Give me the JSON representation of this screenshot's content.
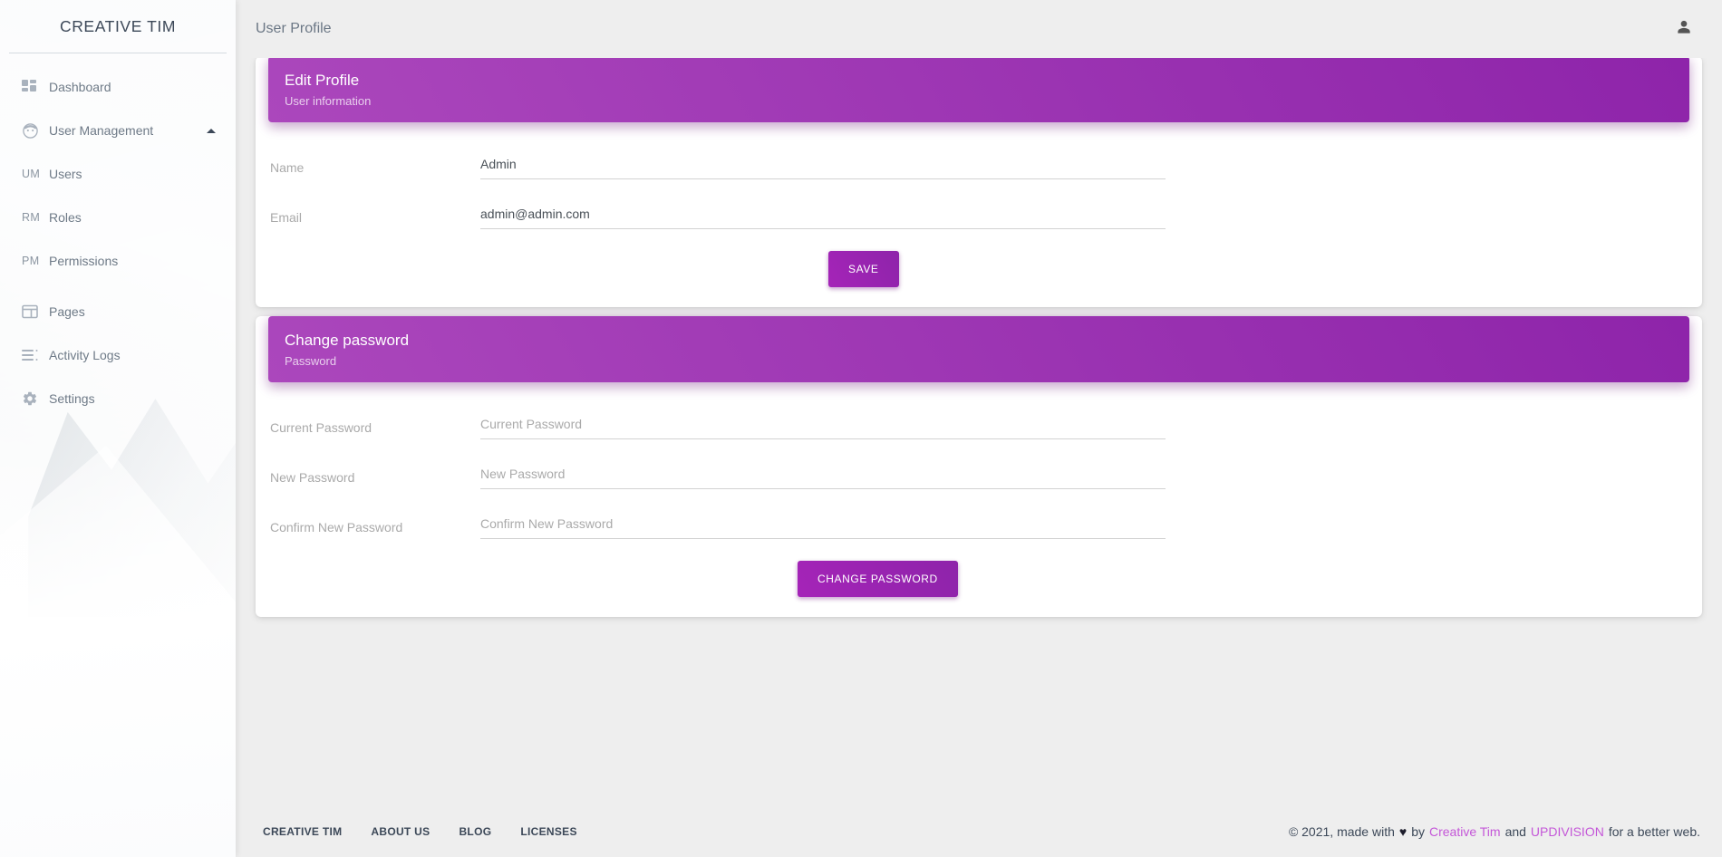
{
  "brand": {
    "name": "CREATIVE TIM"
  },
  "sidebar": {
    "items": [
      {
        "label": "Dashboard",
        "icon": "dashboard-grid-icon",
        "type": "icon"
      },
      {
        "label": "User Management",
        "icon": "user-face-icon",
        "type": "icon",
        "expanded": true,
        "caret": "chevron-up-icon"
      },
      {
        "label": "Users",
        "abbr": "UM",
        "type": "abbr"
      },
      {
        "label": "Roles",
        "abbr": "RM",
        "type": "abbr"
      },
      {
        "label": "Permissions",
        "abbr": "PM",
        "type": "abbr"
      },
      {
        "label": "Pages",
        "icon": "pages-layout-icon",
        "type": "icon"
      },
      {
        "label": "Activity Logs",
        "icon": "list-lines-icon",
        "type": "icon"
      },
      {
        "label": "Settings",
        "icon": "gear-icon",
        "type": "icon"
      }
    ]
  },
  "topbar": {
    "title": "User Profile",
    "account_icon": "person-icon"
  },
  "cards": {
    "edit_profile": {
      "title": "Edit Profile",
      "subtitle": "User information",
      "fields": [
        {
          "label": "Name",
          "value": "Admin",
          "placeholder": "Name",
          "type": "text"
        },
        {
          "label": "Email",
          "value": "admin@admin.com",
          "placeholder": "Email",
          "type": "email"
        }
      ],
      "submit_label": "SAVE"
    },
    "change_password": {
      "title": "Change password",
      "subtitle": "Password",
      "fields": [
        {
          "label": "Current Password",
          "value": "",
          "placeholder": "Current Password",
          "type": "password"
        },
        {
          "label": "New Password",
          "value": "",
          "placeholder": "New Password",
          "type": "password"
        },
        {
          "label": "Confirm New Password",
          "value": "",
          "placeholder": "Confirm New Password",
          "type": "password"
        }
      ],
      "submit_label": "CHANGE PASSWORD"
    }
  },
  "footer": {
    "links": [
      {
        "label": "CREATIVE TIM"
      },
      {
        "label": "ABOUT US"
      },
      {
        "label": "BLOG"
      },
      {
        "label": "LICENSES"
      }
    ],
    "copyright_prefix": "© 2021, made with",
    "heart": "♥",
    "by": "by",
    "link1": "Creative Tim",
    "and": "and",
    "link2": "UPDIVISION",
    "copyright_suffix": "for a better web."
  },
  "colors": {
    "accent": "#9c27b0",
    "accent_light": "#ab47bc",
    "page_bg": "#eeeeee",
    "text_dark": "#3c4858",
    "text_muted": "#aaaaaa"
  }
}
